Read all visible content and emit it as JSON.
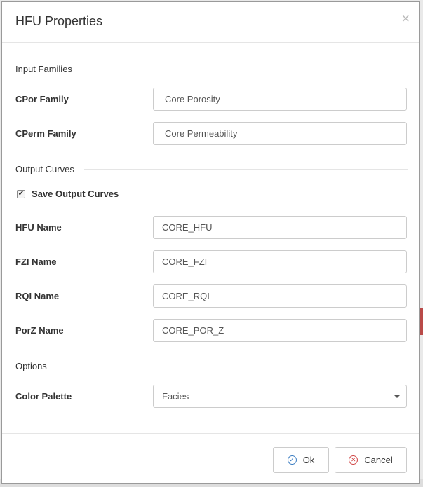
{
  "dialog": {
    "title": "HFU Properties",
    "close_glyph": "×"
  },
  "sections": {
    "input_families": "Input Families",
    "output_curves": "Output Curves",
    "options": "Options"
  },
  "fields": {
    "cpor_family": {
      "label": "CPor Family",
      "value": "Core Porosity"
    },
    "cperm_family": {
      "label": "CPerm Family",
      "value": "Core Permeability"
    },
    "save_output": {
      "label": "Save Output Curves",
      "checked": true,
      "check_glyph": "✔"
    },
    "hfu_name": {
      "label": "HFU Name",
      "value": "CORE_HFU"
    },
    "fzi_name": {
      "label": "FZI Name",
      "value": "CORE_FZI"
    },
    "rqi_name": {
      "label": "RQI Name",
      "value": "CORE_RQI"
    },
    "porz_name": {
      "label": "PorZ Name",
      "value": "CORE_POR_Z"
    },
    "color_palette": {
      "label": "Color Palette",
      "value": "Facies"
    }
  },
  "footer": {
    "ok_label": "Ok",
    "ok_icon": "check-circle-icon",
    "ok_glyph": "✓",
    "cancel_label": "Cancel",
    "cancel_icon": "x-circle-icon",
    "cancel_glyph": "✕"
  },
  "colors": {
    "ok_accent": "#3a7cc1",
    "cancel_accent": "#d04545"
  }
}
